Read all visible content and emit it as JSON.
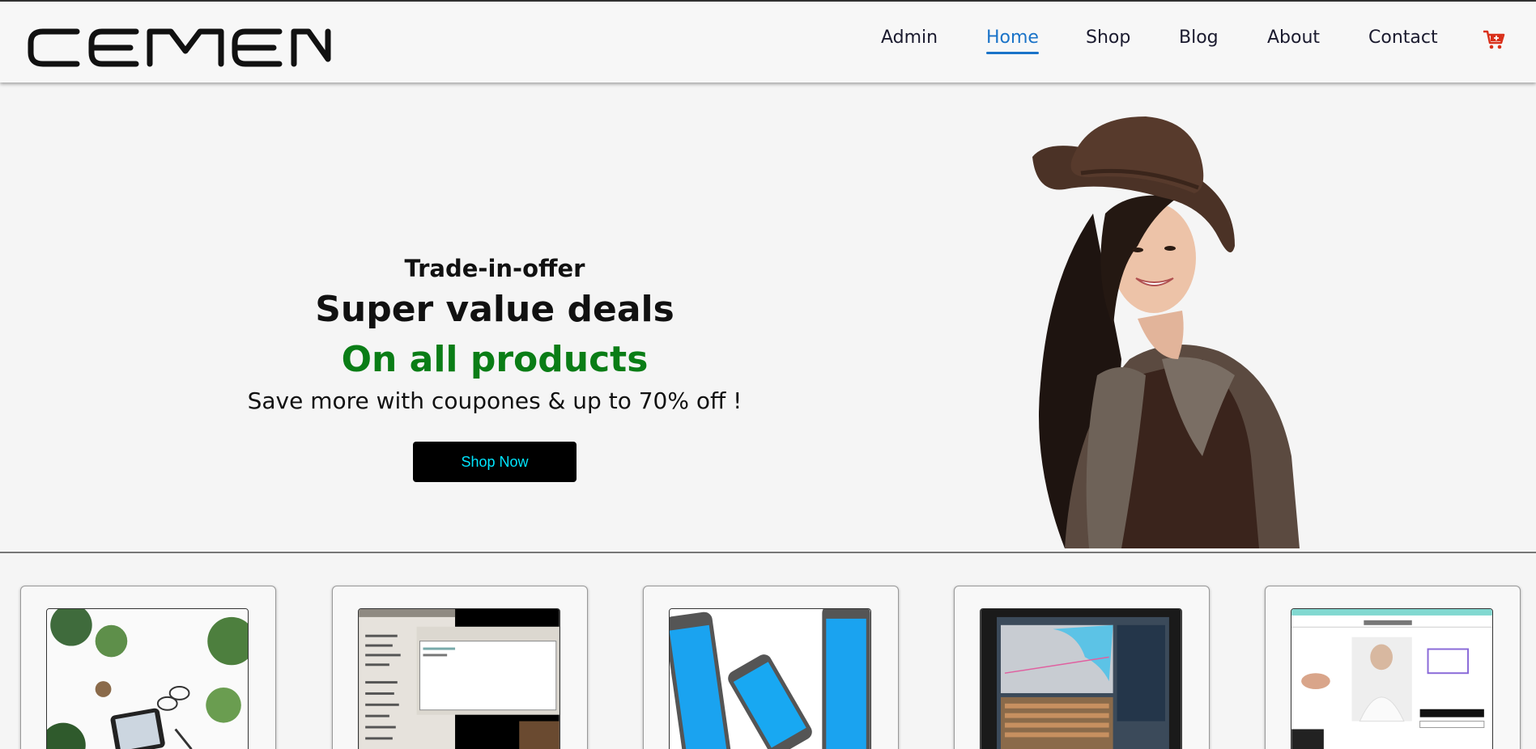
{
  "brand": {
    "logo_text": "CEMEN"
  },
  "nav": {
    "items": [
      {
        "label": "Admin"
      },
      {
        "label": "Home",
        "active": true
      },
      {
        "label": "Shop"
      },
      {
        "label": "Blog"
      },
      {
        "label": "About"
      },
      {
        "label": "Contact"
      }
    ],
    "cart_icon": "shopping-cart-icon"
  },
  "hero": {
    "pre_title": "Trade-in-offer",
    "title": "Super value deals",
    "subtitle": "On all products",
    "description": "Save more with coupones & up to 70% off !",
    "button_label": "Shop Now"
  },
  "colors": {
    "accent": "#1a73c8",
    "highlight_green": "#0a7d16",
    "button_bg": "#000000",
    "button_text": "#00e5ff",
    "cart": "#d9301a"
  },
  "products": [
    {
      "image": "workspace-tablet-plants"
    },
    {
      "image": "chat-app-screenshot"
    },
    {
      "image": "smartphones"
    },
    {
      "image": "navigation-monitor"
    },
    {
      "image": "jewelry-webpage"
    }
  ]
}
